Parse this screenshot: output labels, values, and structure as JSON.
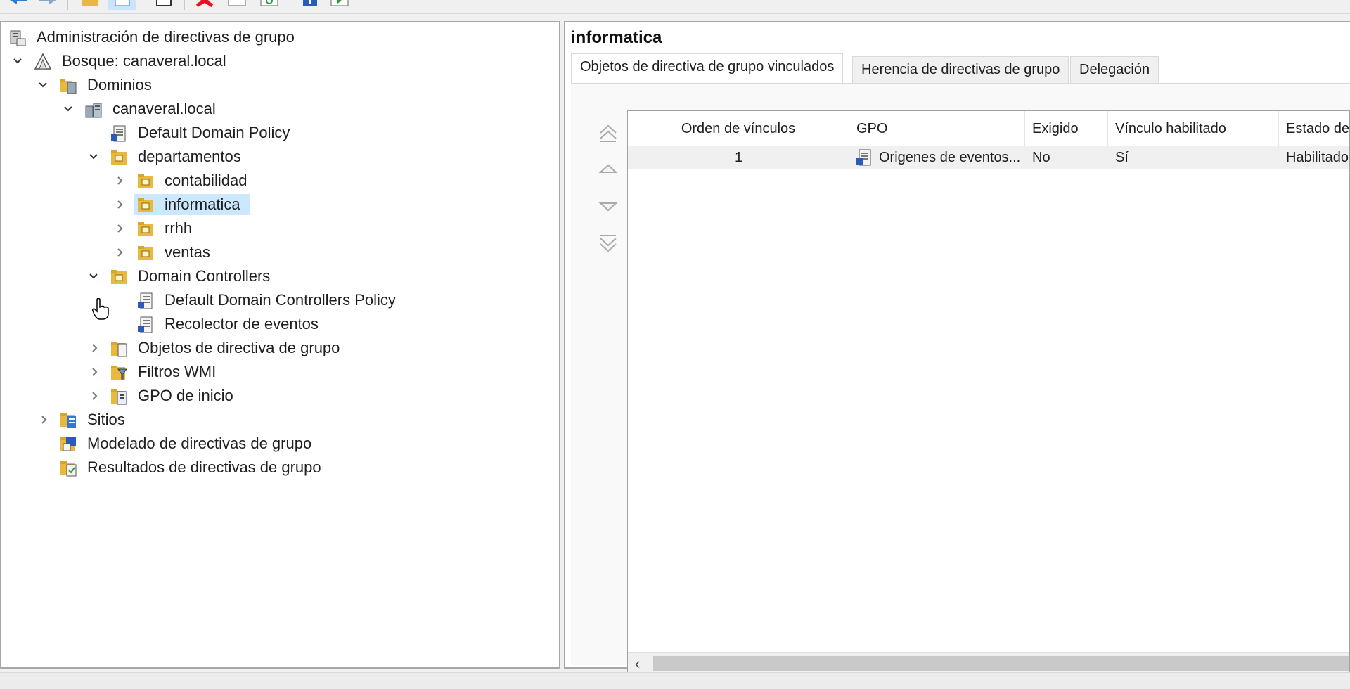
{
  "toolbar": {
    "buttons": [
      {
        "name": "back-arrow-icon"
      },
      {
        "name": "forward-arrow-icon"
      },
      {
        "name": "folder-up-icon"
      },
      {
        "name": "show-hide-tree-icon"
      },
      {
        "name": "print-icon"
      },
      {
        "name": "delete-icon",
        "color": "#e81123"
      },
      {
        "name": "properties-icon"
      },
      {
        "name": "refresh-icon"
      },
      {
        "name": "help-icon"
      },
      {
        "name": "action-pane-icon"
      }
    ]
  },
  "tree": {
    "root_label": "Administración de directivas de grupo",
    "forest_label": "Bosque: canaveral.local",
    "domains_label": "Dominios",
    "domain_label": "canaveral.local",
    "default_domain_policy": "Default Domain Policy",
    "departamentos": "departamentos",
    "contabilidad": "contabilidad",
    "informatica": "informatica",
    "rrhh": "rrhh",
    "ventas": "ventas",
    "domain_controllers": "Domain Controllers",
    "default_dc_policy": "Default Domain Controllers Policy",
    "recolector": "Recolector de eventos",
    "gpo_objects": "Objetos de directiva de grupo",
    "wmi_filters": "Filtros WMI",
    "starter_gpos": "GPO de inicio",
    "sites": "Sitios",
    "modeling": "Modelado de directivas de grupo",
    "results": "Resultados de directivas de grupo",
    "selected_item": "informatica"
  },
  "content": {
    "title": "informatica",
    "tabs": [
      {
        "label": "Objetos de directiva de grupo vinculados",
        "active": true
      },
      {
        "label": "Herencia de directivas de grupo",
        "active": false
      },
      {
        "label": "Delegación",
        "active": false
      }
    ],
    "columns": {
      "order": "Orden de vínculos",
      "gpo": "GPO",
      "enforced": "Exigido",
      "link_enabled": "Vínculo habilitado",
      "status": "Estado de G"
    },
    "rows": [
      {
        "order": "1",
        "gpo": "Origenes de eventos...",
        "enforced": "No",
        "link_enabled": "Sí",
        "status": "Habilitado"
      }
    ]
  },
  "colors": {
    "selection": "#cce8ff",
    "row_highlight": "#f0f0f0",
    "folder": "#e8b93c",
    "pane_border": "#a8a8a8"
  }
}
